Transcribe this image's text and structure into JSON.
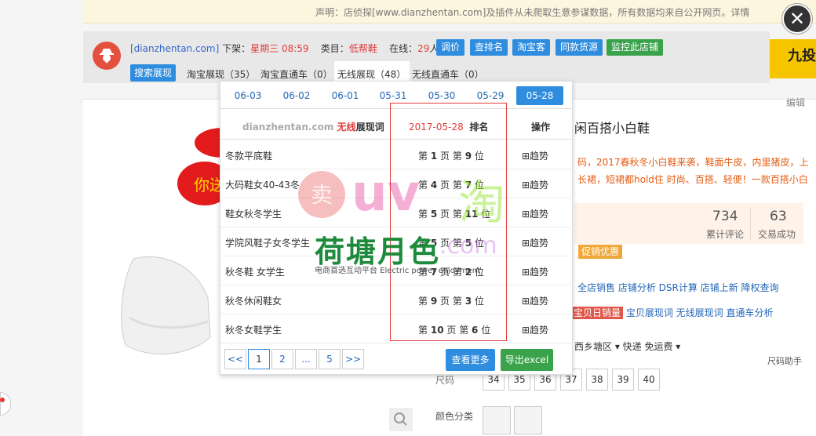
{
  "notice": {
    "text": "声明：店侦探[www.dianzhentan.com]及插件从未爬取生意参谋数据，所有数据均来自公开网页。详情"
  },
  "close_glyph": "✕",
  "toolbar": {
    "site": "[dianzhentan.com]",
    "offline_label": "下架：",
    "offline_value": "星期三 08:59",
    "category_label": "类目：",
    "category_value": "低帮鞋",
    "online_label": "在线：",
    "online_value": "29",
    "online_unit": "人",
    "buttons": [
      "调价",
      "查排名",
      "淘宝客",
      "同款货源"
    ],
    "monitor_button": "监控此店铺",
    "tabs": {
      "search": "搜索展现",
      "taobao": "淘宝展现（35）",
      "ztc": "淘宝直通车（0）",
      "wireless": "无线展现（48）",
      "wireless_ztc": "无线直通车（0）"
    }
  },
  "ad": {
    "text": "九投"
  },
  "page": {
    "edit": "编辑",
    "balloon_text": "你送",
    "title": "闲百搭小白鞋",
    "desc": "码，2017春秋冬小白鞋来袭，鞋面牛皮，内里猪皮，上长裙，短裙都hold住 时尚、百搭、轻便！一款百搭小白",
    "stats": [
      {
        "num": "734",
        "label": "累计评论"
      },
      {
        "num": "63",
        "label": "交易成功"
      }
    ],
    "promo": "促销优惠",
    "links1": "全店销售  店铺分析  DSR计算  店铺上新  降权查询",
    "badge": "宝贝日销量",
    "links2": "宝贝展现词  无线展现词  直通车分析",
    "shipping": "西乡塘区 ▾    快递 免运费 ▾",
    "size_help": "尺码助手",
    "size_label": "尺码",
    "sizes": [
      "34",
      "35",
      "36",
      "37",
      "38",
      "39",
      "40"
    ],
    "color_label": "颜色分类"
  },
  "popup": {
    "dates": [
      "06-03",
      "06-02",
      "06-01",
      "05-31",
      "05-30",
      "05-29",
      "05-28"
    ],
    "active_date": "05-28",
    "head": {
      "site": "dianzhentan.com",
      "wireless": "无线",
      "keyword": "展现词",
      "date": "2017-05-28",
      "rank": "排名",
      "action": "操作"
    },
    "rows": [
      {
        "keyword": "冬款平底鞋",
        "page": "1",
        "pos": "9",
        "trend": "⊞趋势"
      },
      {
        "keyword": "大码鞋女40-43冬",
        "page": "4",
        "pos": "7",
        "trend": "⊞趋势"
      },
      {
        "keyword": "鞋女秋冬学生",
        "page": "5",
        "pos": "11",
        "trend": "⊞趋势"
      },
      {
        "keyword": "学院风鞋子女冬学生",
        "page": "5",
        "pos": "5",
        "trend": "⊞趋势"
      },
      {
        "keyword": "秋冬鞋 女学生",
        "page": "7",
        "pos": "2",
        "trend": "⊞趋势"
      },
      {
        "keyword": "秋冬休闲鞋女",
        "page": "9",
        "pos": "3",
        "trend": "⊞趋势"
      },
      {
        "keyword": "秋冬女鞋学生",
        "page": "10",
        "pos": "6",
        "trend": "⊞趋势"
      }
    ],
    "rank_prefix": "第",
    "page_word": "页 第",
    "pos_word": "位",
    "pager": [
      "<<",
      "1",
      "2",
      "...",
      "5",
      ">>"
    ],
    "more": "查看更多",
    "excel": "导出excel"
  },
  "watermark": {
    "uv": "uv",
    "tao": "淘",
    "dotcom": ".com",
    "brand": "荷塘月色",
    "sub": "电商首选互动平台 Electric power enjoyment",
    "seal": "卖"
  }
}
